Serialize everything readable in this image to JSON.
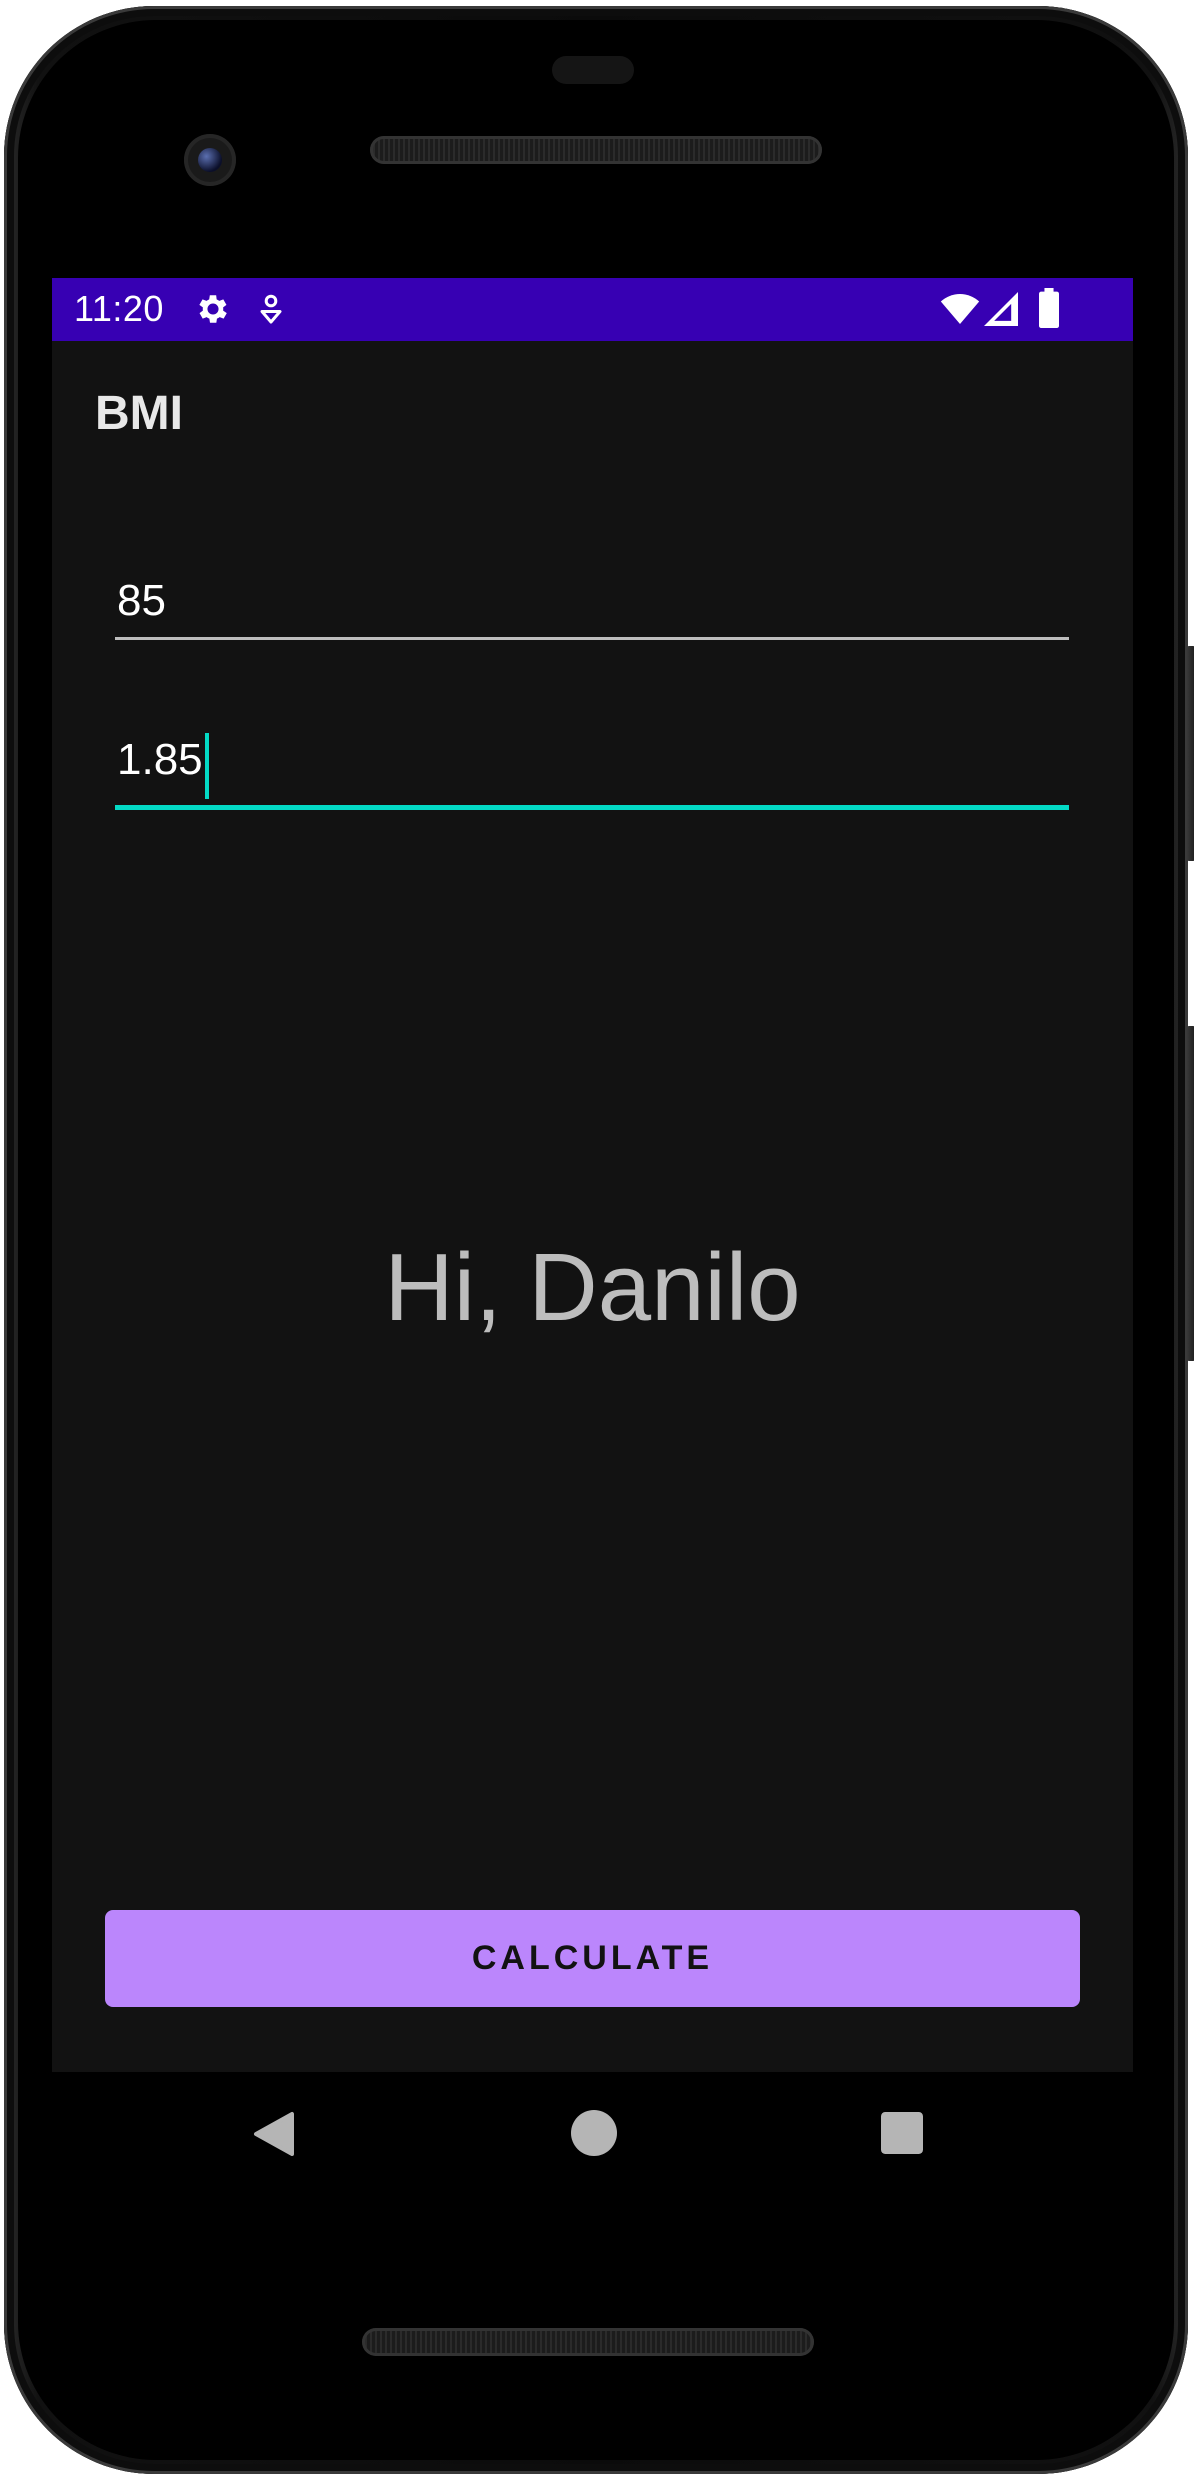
{
  "status_bar": {
    "time": "11:20",
    "left_icons": [
      "gear-icon",
      "location-pin-icon"
    ],
    "right_icons": [
      "wifi-icon",
      "cellular-signal-icon",
      "battery-icon"
    ],
    "background_color": "#3700b3"
  },
  "app_bar": {
    "title": "BMI"
  },
  "form": {
    "weight_value": "85",
    "height_value": "1.85",
    "focused_field": "height",
    "accent_color": "#03dac5"
  },
  "greeting": "Hi, Danilo",
  "calculate_button": {
    "label": "CALCULATE",
    "color": "#bb86fc"
  },
  "navigation_bar": {
    "items": [
      "back-icon",
      "home-icon",
      "recents-icon"
    ]
  }
}
